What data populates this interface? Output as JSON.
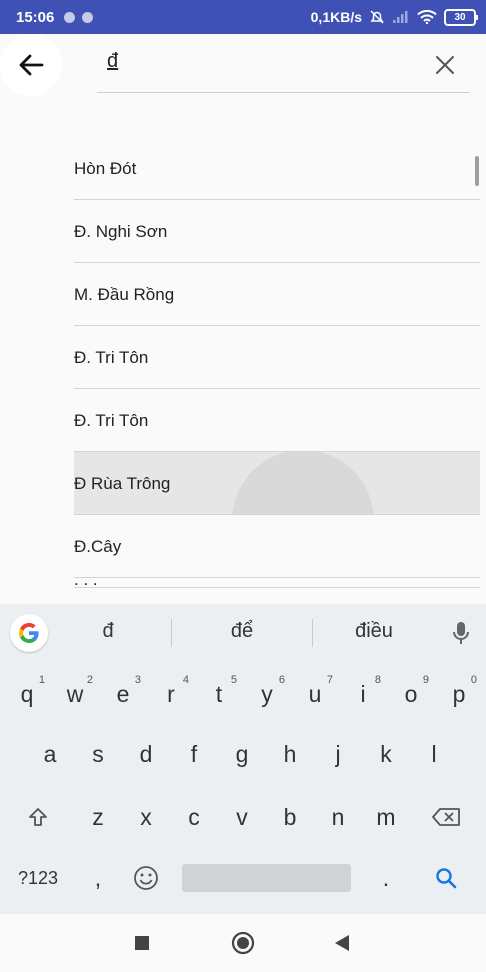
{
  "status": {
    "time": "15:06",
    "network_speed": "0,1KB/s",
    "battery": "30"
  },
  "search": {
    "query": "đ"
  },
  "results": [
    "Hòn Đót",
    "Đ. Nghi Sơn",
    "M. Đầu Rồng",
    "Đ. Tri Tôn",
    "Đ. Tri Tôn",
    "Đ Rùa Trông",
    "Đ.Cây",
    ". . ."
  ],
  "keyboard": {
    "suggestions": [
      "đ",
      "để",
      "điều"
    ],
    "row1": [
      {
        "k": "q",
        "h": "1"
      },
      {
        "k": "w",
        "h": "2"
      },
      {
        "k": "e",
        "h": "3"
      },
      {
        "k": "r",
        "h": "4"
      },
      {
        "k": "t",
        "h": "5"
      },
      {
        "k": "y",
        "h": "6"
      },
      {
        "k": "u",
        "h": "7"
      },
      {
        "k": "i",
        "h": "8"
      },
      {
        "k": "o",
        "h": "9"
      },
      {
        "k": "p",
        "h": "0"
      }
    ],
    "row2": [
      "a",
      "s",
      "d",
      "f",
      "g",
      "h",
      "j",
      "k",
      "l"
    ],
    "row3": [
      "z",
      "x",
      "c",
      "v",
      "b",
      "n",
      "m"
    ],
    "symbols_label": "?123",
    "comma": ",",
    "period": "."
  },
  "icons": {
    "back": "arrow-left-icon",
    "clear": "close-icon",
    "mic": "microphone-icon",
    "search": "search-icon",
    "shift": "shift-icon",
    "backspace": "backspace-icon",
    "emoji": "emoji-icon"
  },
  "colors": {
    "statusbar": "#3f51b5",
    "accent_search_key": "#1a73e8"
  }
}
